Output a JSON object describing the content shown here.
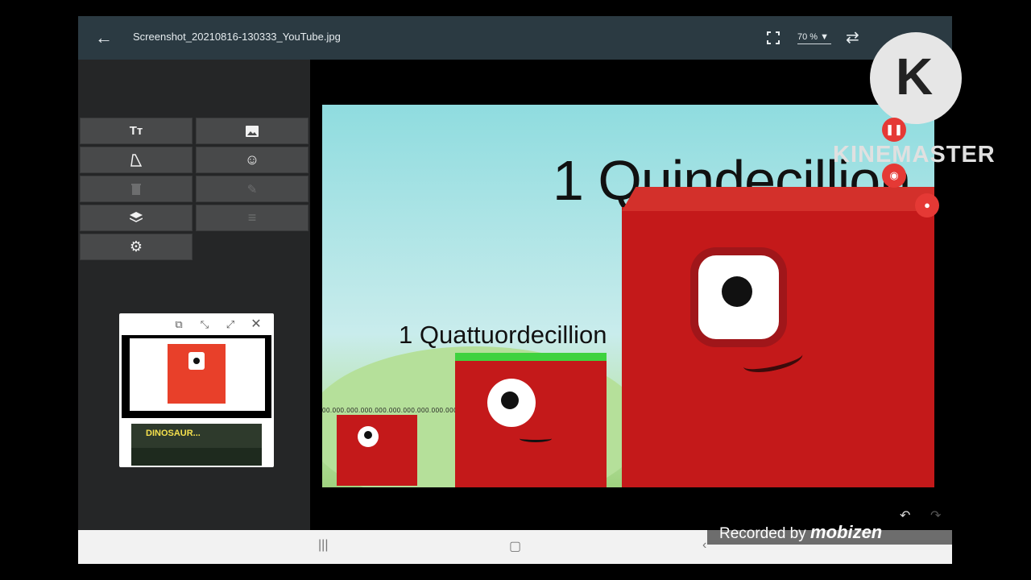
{
  "topbar": {
    "back_icon": "arrow-left-icon",
    "filename": "Screenshot_20210816-130333_YouTube.jpg",
    "zoom": "70 %",
    "fullscreen_icon": "fullscreen-icon",
    "swap_icon": "swap-icon"
  },
  "tools": [
    {
      "icon": "text-icon",
      "glyph": "Tт"
    },
    {
      "icon": "image-icon",
      "glyph": "▣"
    },
    {
      "icon": "crop-icon",
      "glyph": "◺"
    },
    {
      "icon": "emoji-icon",
      "glyph": "☺"
    },
    {
      "icon": "delete-icon",
      "glyph": "🗑"
    },
    {
      "icon": "pencil-icon",
      "glyph": "✎"
    },
    {
      "icon": "layers-icon",
      "glyph": "◈"
    },
    {
      "icon": "menu-icon",
      "glyph": "≡"
    },
    {
      "icon": "settings-icon",
      "glyph": "⚙"
    }
  ],
  "pip": {
    "overlay_text": "DINOSAUR..."
  },
  "canvas": {
    "big_label": "1 Quindecillion",
    "mid_label": "1 Quattuordecillion",
    "small_digits": "00.000.000.000.000.000.000.000.000.000.000.000"
  },
  "overlays": {
    "kinemaster_logo_letter": "K",
    "kinemaster_text": "KINEMASTER",
    "recorded_by": "Recorded by",
    "recorder_brand": "mobizen"
  },
  "colors": {
    "topbar": "#2b3a42",
    "panel": "#252627",
    "tool": "#48494a",
    "block_red": "#c4191a",
    "record_red": "#e53935"
  }
}
